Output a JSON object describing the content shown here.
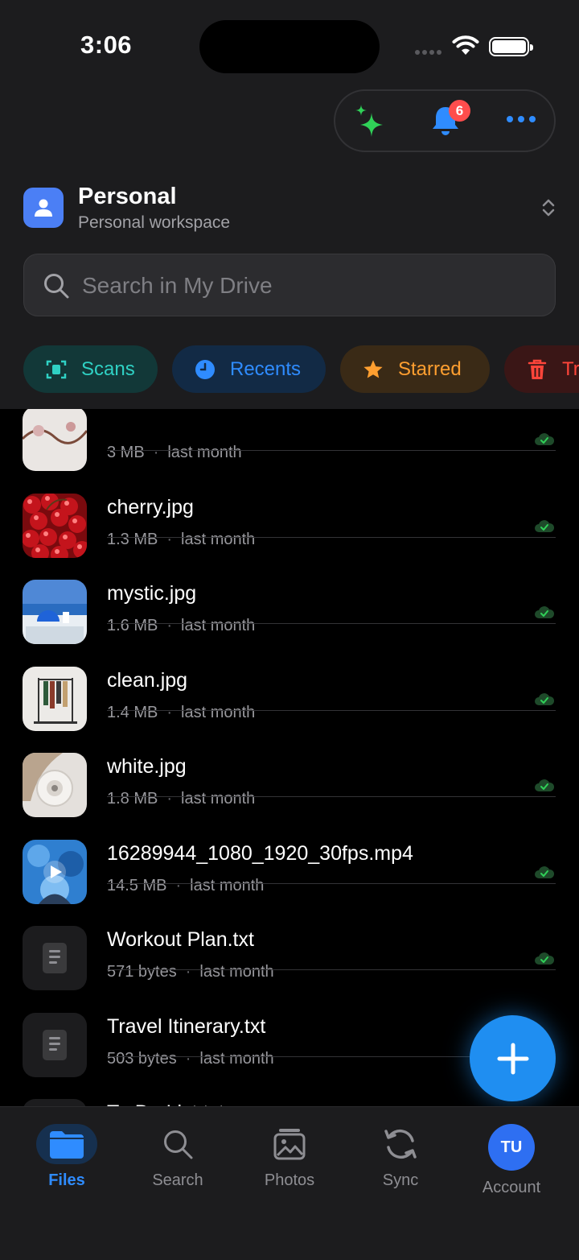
{
  "status_bar": {
    "time": "3:06"
  },
  "top_actions": {
    "notification_count": "6"
  },
  "workspace": {
    "title": "Personal",
    "subtitle": "Personal workspace"
  },
  "search": {
    "placeholder": "Search in My Drive"
  },
  "chips": [
    {
      "label": "Scans",
      "color": "#2fd1c4",
      "bg": "#123838"
    },
    {
      "label": "Recents",
      "color": "#2f8cff",
      "bg": "#122a45"
    },
    {
      "label": "Starred",
      "color": "#ff9f30",
      "bg": "#3a2a16"
    },
    {
      "label": "Tra",
      "color": "#ff453a",
      "bg": "#3a1616"
    }
  ],
  "files": [
    {
      "name": "",
      "size": "3 MB",
      "date": "last month",
      "thumb": "flowers"
    },
    {
      "name": "cherry.jpg",
      "size": "1.3 MB",
      "date": "last month",
      "thumb": "cherry"
    },
    {
      "name": "mystic.jpg",
      "size": "1.6 MB",
      "date": "last month",
      "thumb": "mystic"
    },
    {
      "name": "clean.jpg",
      "size": "1.4 MB",
      "date": "last month",
      "thumb": "clean"
    },
    {
      "name": "white.jpg",
      "size": "1.8 MB",
      "date": "last month",
      "thumb": "white"
    },
    {
      "name": "16289944_1080_1920_30fps.mp4",
      "size": "14.5 MB",
      "date": "last month",
      "thumb": "video"
    },
    {
      "name": "Workout Plan.txt",
      "size": "571 bytes",
      "date": "last month",
      "thumb": "doc"
    },
    {
      "name": "Travel Itinerary.txt",
      "size": "503 bytes",
      "date": "last month",
      "thumb": "doc"
    },
    {
      "name": "To-Do List.txt",
      "size": "",
      "date": "",
      "thumb": "doc"
    }
  ],
  "tabs": [
    {
      "label": "Files",
      "icon": "folder-icon",
      "active": true
    },
    {
      "label": "Search",
      "icon": "search-icon",
      "active": false
    },
    {
      "label": "Photos",
      "icon": "photos-icon",
      "active": false
    },
    {
      "label": "Sync",
      "icon": "sync-icon",
      "active": false
    },
    {
      "label": "Account",
      "icon": "avatar",
      "active": false
    }
  ],
  "account": {
    "initials": "TU"
  },
  "colors": {
    "accent": "#2f8cff",
    "synced": "#30d158",
    "fab": "#1f8ef1"
  }
}
